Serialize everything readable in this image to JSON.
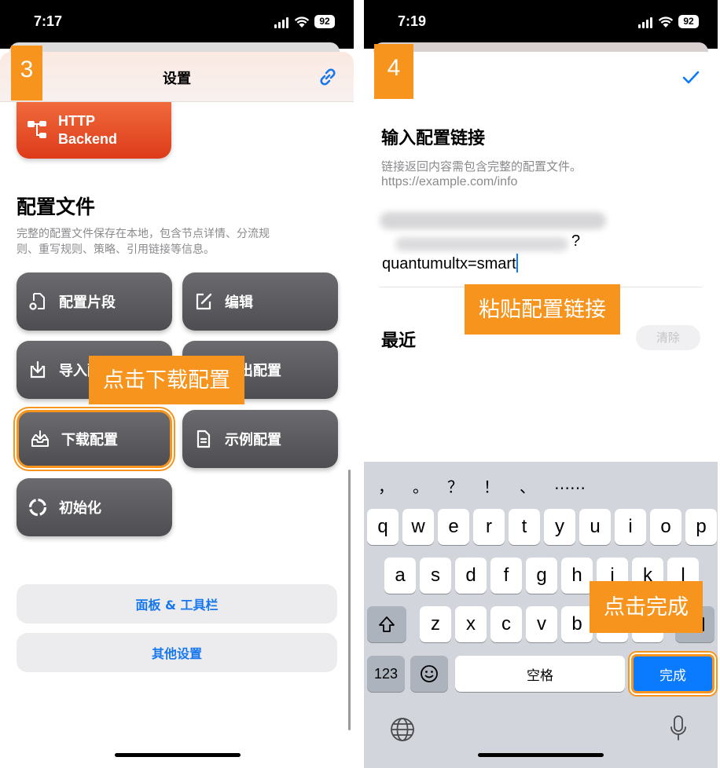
{
  "left": {
    "status": {
      "time": "7:17",
      "battery": "92"
    },
    "step": "3",
    "nav": {
      "title": "设置",
      "back_icon": "chevron-left-icon",
      "link_icon": "link-icon"
    },
    "http_backend": {
      "label_line1": "HTTP",
      "label_line2": "Backend",
      "icon": "flow-tree-icon"
    },
    "section": {
      "title": "配置文件",
      "description_line1": "完整的配置文件保存在本地，包含节点详情、分流规",
      "description_line2": "则、重写规则、策略、引用链接等信息。"
    },
    "buttons": {
      "config_snippet": "配置片段",
      "edit": "编辑",
      "import_config": "导入配置",
      "export_config": "导出配置",
      "download_config": "下载配置",
      "sample_config": "示例配置",
      "initialize": "初始化"
    },
    "callout": "点击下载配置",
    "pills": {
      "panel_toolbar": "面板 & 工具栏",
      "other_settings": "其他设置"
    }
  },
  "right": {
    "status": {
      "time": "7:19",
      "battery": "92"
    },
    "step": "4",
    "heading": "输入配置链接",
    "desc_line1": "链接返回内容需包含完整的配置文件。",
    "desc_line2": "https://example.com/info",
    "input_text": "quantumultx=smart",
    "redacted_suffix": "?",
    "callout_paste": "粘贴配置链接",
    "recent_label": "最近",
    "clear_button": "清除",
    "callout_done": "点击完成",
    "keyboard": {
      "suggestions": [
        "，",
        "。",
        "？",
        "！",
        "、",
        "……"
      ],
      "row1": [
        "q",
        "w",
        "e",
        "r",
        "t",
        "y",
        "u",
        "i",
        "o",
        "p"
      ],
      "row2": [
        "a",
        "s",
        "d",
        "f",
        "g",
        "h",
        "j",
        "k",
        "l"
      ],
      "row3": [
        "z",
        "x",
        "c",
        "v",
        "b",
        "n",
        "m"
      ],
      "numbers": "123",
      "space": "空格",
      "done": "完成"
    },
    "colors": {
      "accent": "#0a7aff",
      "callout": "#f7941d",
      "backend_red": "#e8421c"
    }
  }
}
